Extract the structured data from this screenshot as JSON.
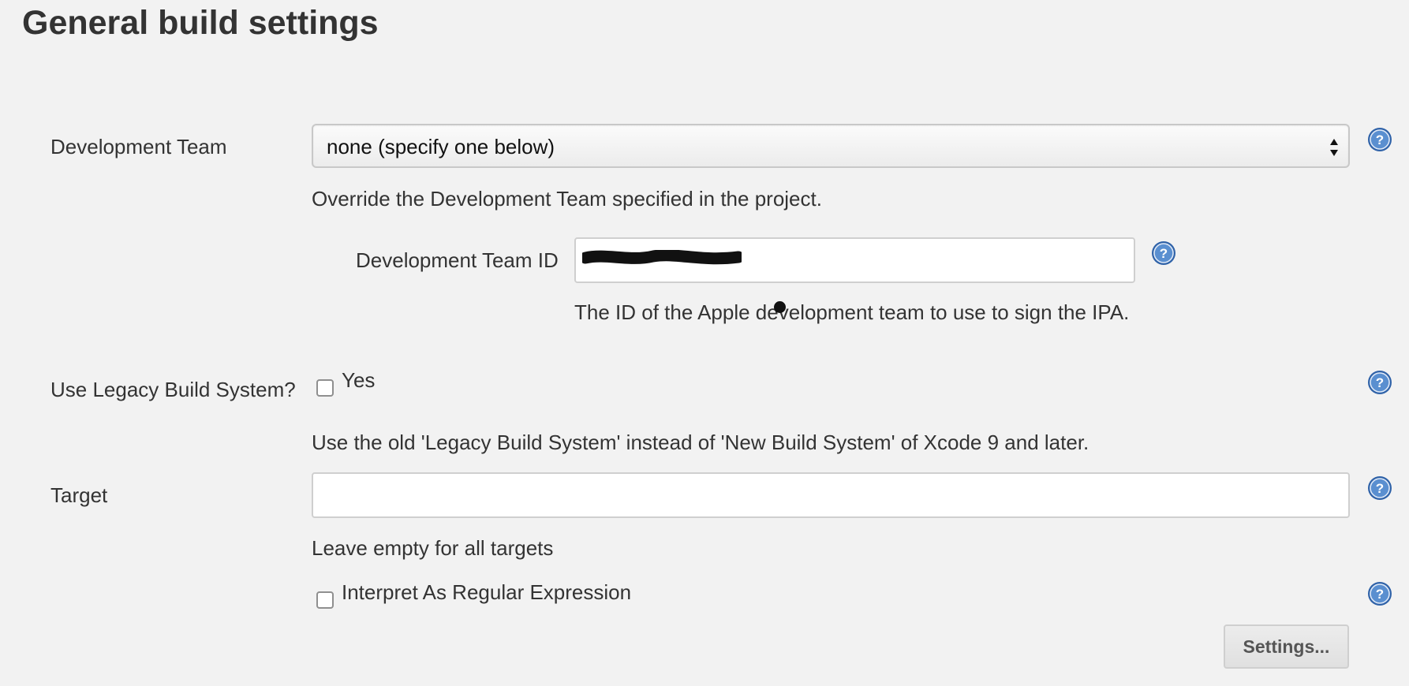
{
  "section": {
    "title": "General build settings"
  },
  "dev_team": {
    "label": "Development Team",
    "selected": "none (specify one below)",
    "description": "Override the Development Team specified in the project."
  },
  "dev_team_id": {
    "label": "Development Team ID",
    "description": "The ID of the Apple development team to use to sign the IPA."
  },
  "legacy_build": {
    "label": "Use Legacy Build System?",
    "checkbox_label": "Yes",
    "checked": false,
    "description": "Use the old 'Legacy Build System' instead of 'New Build System' of Xcode 9 and later."
  },
  "target": {
    "label": "Target",
    "value": "",
    "description": "Leave empty for all targets"
  },
  "regex": {
    "checkbox_label": "Interpret As Regular Expression",
    "checked": false
  },
  "buttons": {
    "settings": "Settings..."
  },
  "icons": {
    "help": "help-icon",
    "help_color": "#3a6fb3"
  }
}
